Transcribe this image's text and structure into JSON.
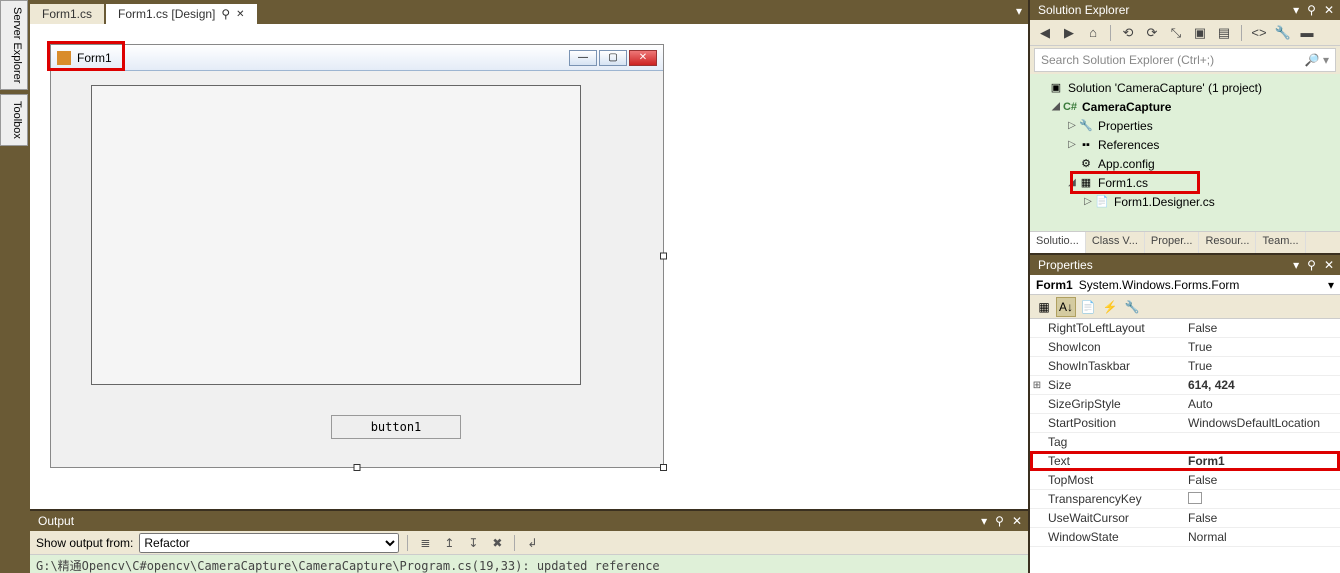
{
  "left_tabs": {
    "server_explorer": "Server Explorer",
    "toolbox": "Toolbox"
  },
  "doc_tabs": {
    "cs": "Form1.cs",
    "design": "Form1.cs [Design]",
    "pin": "⚲",
    "close": "✕"
  },
  "form": {
    "title": "Form1",
    "button": "button1",
    "min": "—",
    "max": "▢",
    "close": "✕"
  },
  "output": {
    "title": "Output",
    "from_label": "Show output from:",
    "from_value": "Refactor",
    "line": "G:\\精通Opencv\\C#opencv\\CameraCapture\\CameraCapture\\Program.cs(19,33): updated reference"
  },
  "se": {
    "title": "Solution Explorer",
    "search_placeholder": "Search Solution Explorer (Ctrl+;)",
    "solution": "Solution 'CameraCapture' (1 project)",
    "project": "CameraCapture",
    "properties": "Properties",
    "references": "References",
    "appconfig": "App.config",
    "form1cs": "Form1.cs",
    "form1designer": "Form1.Designer.cs",
    "tabs": {
      "solution": "Solutio...",
      "classview": "Class V...",
      "properties": "Proper...",
      "resources": "Resour...",
      "team": "Team..."
    }
  },
  "props": {
    "title": "Properties",
    "target_name": "Form1",
    "target_type": "System.Windows.Forms.Form",
    "rows": [
      {
        "n": "RightToLeftLayout",
        "v": "False"
      },
      {
        "n": "ShowIcon",
        "v": "True"
      },
      {
        "n": "ShowInTaskbar",
        "v": "True"
      },
      {
        "n": "Size",
        "v": "614, 424",
        "bold": true,
        "exp": true
      },
      {
        "n": "SizeGripStyle",
        "v": "Auto"
      },
      {
        "n": "StartPosition",
        "v": "WindowsDefaultLocation"
      },
      {
        "n": "Tag",
        "v": ""
      },
      {
        "n": "Text",
        "v": "Form1",
        "bold": true,
        "hl": true
      },
      {
        "n": "TopMost",
        "v": "False"
      },
      {
        "n": "TransparencyKey",
        "v": "",
        "swatch": true
      },
      {
        "n": "UseWaitCursor",
        "v": "False"
      },
      {
        "n": "WindowState",
        "v": "Normal"
      }
    ]
  },
  "icons": {
    "chevron": "▾",
    "pin": "⚲",
    "close": "✕",
    "search": "🔍",
    "back": "◀",
    "fwd": "▶",
    "home": "⌂",
    "refresh": "⟳",
    "collapse": "⤢",
    "showall": "▣",
    "props_cat": "▦",
    "props_az": "A↓",
    "props_pages": "📄",
    "bolt": "⚡",
    "wrench": "🔧"
  }
}
